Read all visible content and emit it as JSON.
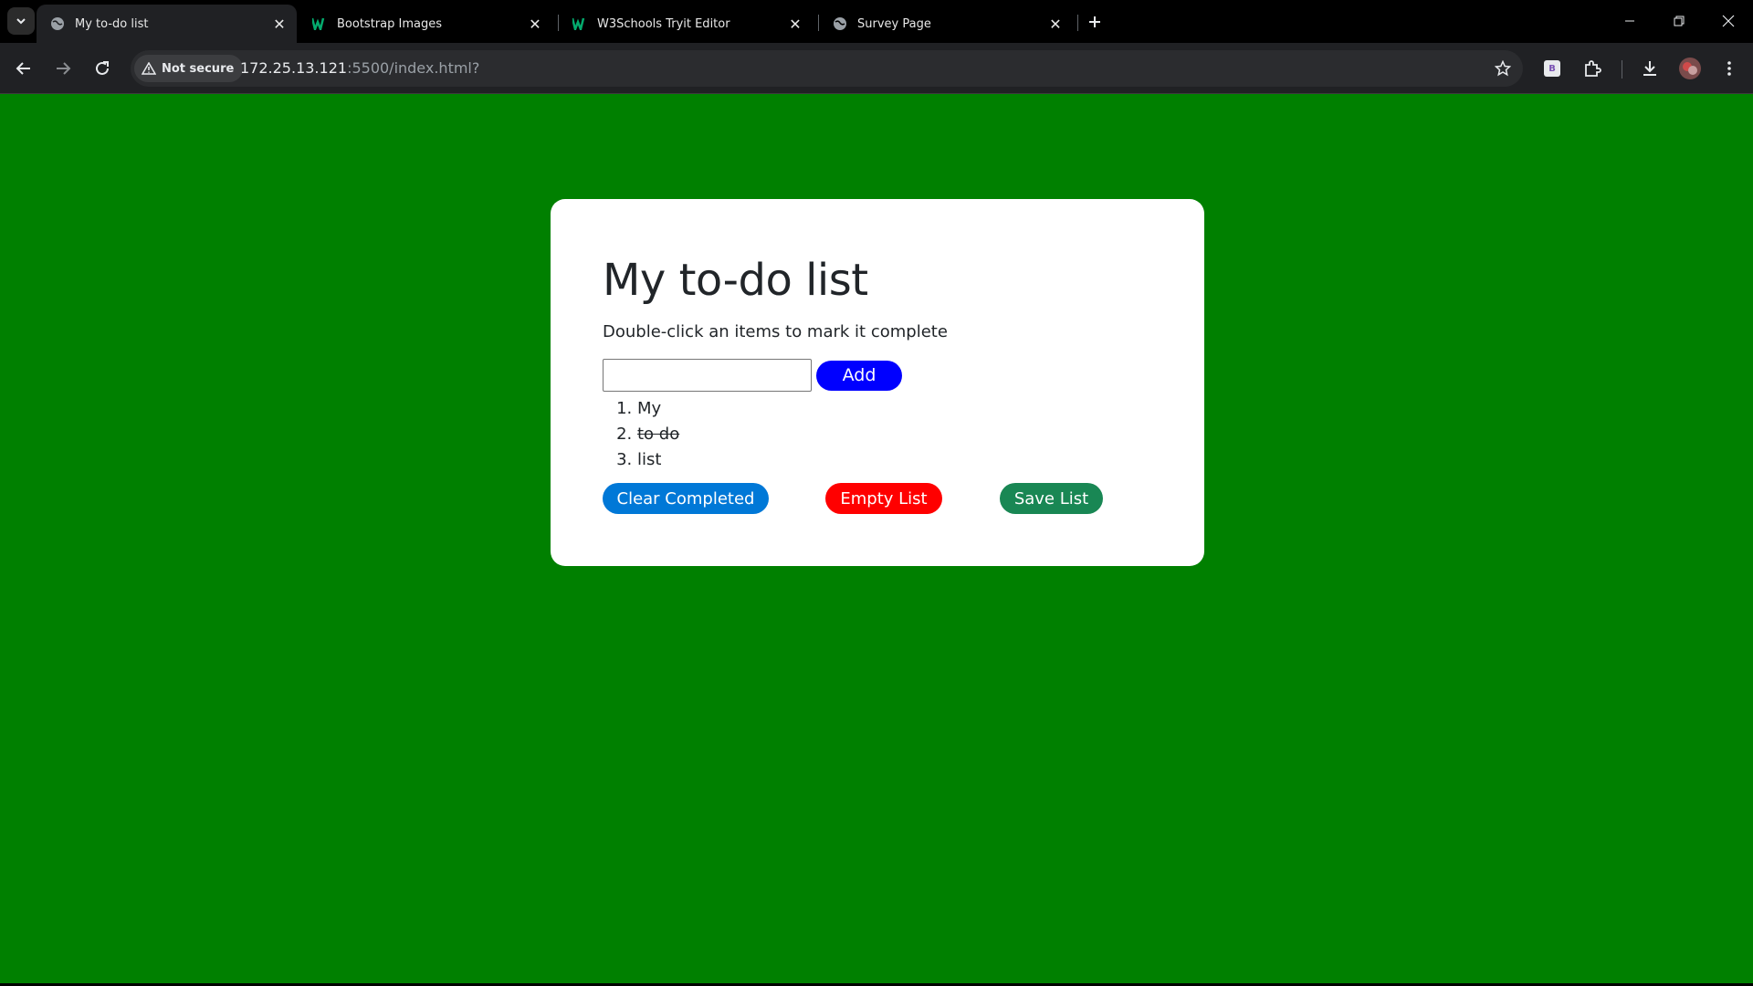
{
  "browser": {
    "tabs": [
      {
        "title": "My to-do list",
        "active": true,
        "favicon": "globe-icon"
      },
      {
        "title": "Bootstrap Images",
        "active": false,
        "favicon": "w3schools-icon"
      },
      {
        "title": "W3Schools Tryit Editor",
        "active": false,
        "favicon": "w3schools-icon"
      },
      {
        "title": "Survey Page",
        "active": false,
        "favicon": "globe-icon"
      }
    ],
    "security_label": "Not secure",
    "url_host": "172.25.13.121",
    "url_rest": ":5500/index.html?",
    "profile_badge": "B"
  },
  "page": {
    "background_color": "#008000",
    "title": "My to-do list",
    "subtitle": "Double-click an items to mark it complete",
    "input_value": "",
    "add_label": "Add",
    "items": [
      {
        "text": "My",
        "completed": false
      },
      {
        "text": "to do",
        "completed": true
      },
      {
        "text": "list",
        "completed": false
      }
    ],
    "clear_completed_label": "Clear Completed",
    "empty_list_label": "Empty List",
    "save_list_label": "Save List",
    "colors": {
      "add": "#0000ff",
      "clear_completed": "#0078d7",
      "empty_list": "#ff0000",
      "save_list": "#198754"
    }
  }
}
